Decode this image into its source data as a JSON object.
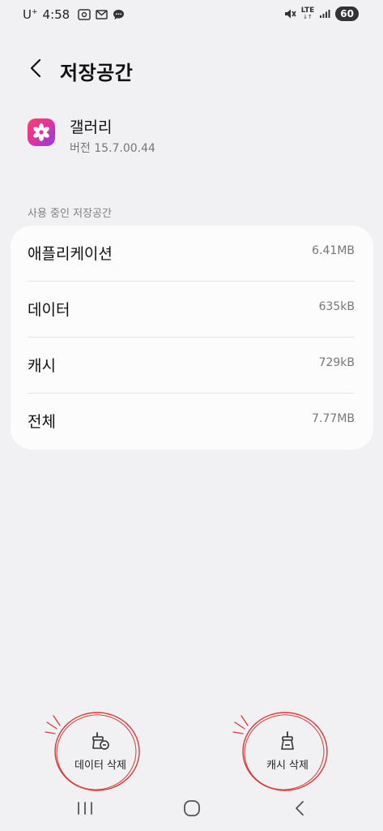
{
  "status_bar": {
    "carrier": "U",
    "carrier_sup": "+",
    "time": "4:58",
    "network": "LTE",
    "battery": "60"
  },
  "header": {
    "title": "저장공간"
  },
  "app": {
    "name": "갤러리",
    "version": "버전 15.7.00.44"
  },
  "storage": {
    "section_label": "사용 중인 저장공간",
    "rows": [
      {
        "label": "애플리케이션",
        "value": "6.41MB"
      },
      {
        "label": "데이터",
        "value": "635kB"
      },
      {
        "label": "캐시",
        "value": "729kB"
      },
      {
        "label": "전체",
        "value": "7.77MB"
      }
    ]
  },
  "actions": {
    "clear_data": "데이터 삭제",
    "clear_cache": "캐시 삭제"
  },
  "colors": {
    "background": "#f1f0f3",
    "card": "#fcfcfd",
    "annotation": "#d63a3a"
  }
}
